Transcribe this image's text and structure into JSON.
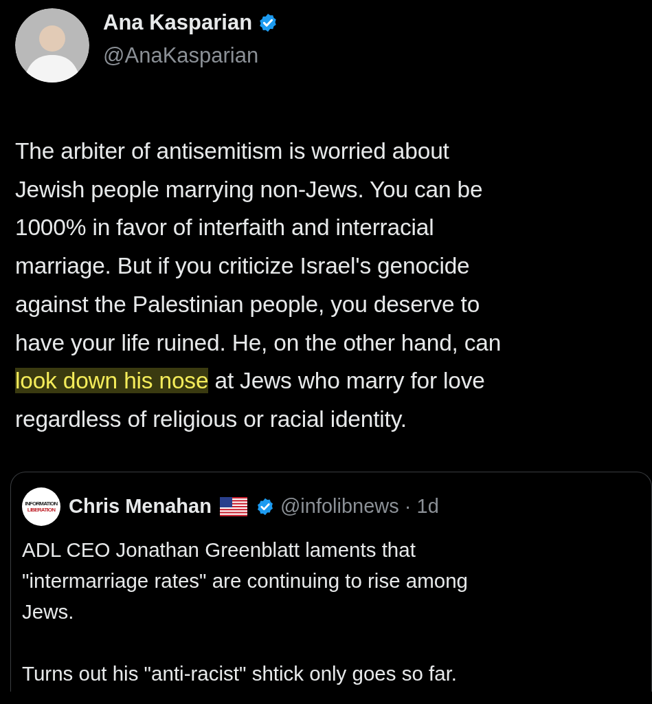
{
  "tweet": {
    "author": {
      "name": "Ana Kasparian",
      "verified": true,
      "handle": "@AnaKasparian"
    },
    "body": [
      [
        {
          "text": "The arbiter of antisemitism is worried about",
          "highlighted": false
        }
      ],
      [
        {
          "text": "Jewish people marrying non-Jews. You can be",
          "highlighted": false
        }
      ],
      [
        {
          "text": "1000% in favor of interfaith and interracial",
          "highlighted": false
        }
      ],
      [
        {
          "text": "marriage. But if you criticize Israel's genocide",
          "highlighted": false
        }
      ],
      [
        {
          "text": "against the Palestinian people, you deserve to",
          "highlighted": false
        }
      ],
      [
        {
          "text": "have your life ruined. He, on the other hand, can",
          "highlighted": false
        }
      ],
      [
        {
          "text": "look down his nose",
          "highlighted": true
        },
        {
          "text": " at Jews who marry for love",
          "highlighted": false
        }
      ],
      [
        {
          "text": "regardless of religious or racial identity.",
          "highlighted": false
        }
      ]
    ],
    "quoted": {
      "logo_lines": [
        "INFORMATION",
        "LIBERATION"
      ],
      "name": "Chris Menahan",
      "verified": true,
      "handle": "@infolibnews",
      "time": "· 1d",
      "paragraphs": [
        [
          "ADL CEO Jonathan Greenblatt laments that",
          "\"intermarriage rates\" are continuing to rise among",
          "Jews."
        ],
        [
          "Turns out his \"anti-racist\" shtick only goes so far."
        ]
      ]
    }
  }
}
